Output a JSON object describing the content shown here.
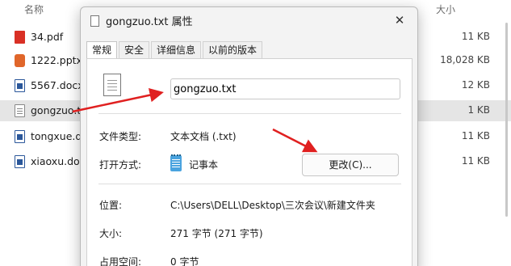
{
  "explorer": {
    "columns": {
      "name": "名称",
      "size": "大小"
    },
    "files": [
      {
        "name": "34.pdf",
        "size": "11 KB",
        "icon": "pdf-icon",
        "selected": false
      },
      {
        "name": "1222.pptx",
        "size": "18,028 KB",
        "icon": "pptx-icon",
        "selected": false
      },
      {
        "name": "5567.docx",
        "size": "12 KB",
        "icon": "docx-icon",
        "selected": false
      },
      {
        "name": "gongzuo.txt",
        "size": "1 KB",
        "icon": "txt-icon",
        "selected": true
      },
      {
        "name": "tongxue.docx",
        "size": "11 KB",
        "icon": "docx-icon",
        "selected": false
      },
      {
        "name": "xiaoxu.docx",
        "size": "11 KB",
        "icon": "docx-icon",
        "selected": false
      }
    ]
  },
  "dialog": {
    "title": "gongzuo.txt 属性",
    "close": "✕",
    "tabs": [
      "常规",
      "安全",
      "详细信息",
      "以前的版本"
    ],
    "active_tab": 0,
    "filename": "gongzuo.txt",
    "file_type_label": "文件类型:",
    "file_type_value": "文本文档 (.txt)",
    "open_with_label": "打开方式:",
    "open_with_value": "记事本",
    "change_button": "更改(C)...",
    "location_label": "位置:",
    "location_value": "C:\\Users\\DELL\\Desktop\\三次会议\\新建文件夹",
    "size_label": "大小:",
    "size_value": "271 字节 (271 字节)",
    "disk_label": "占用空间:",
    "disk_value": "0 字节"
  },
  "colors": {
    "annotation_arrow": "#e02020",
    "selection": "#e5e5e5"
  }
}
